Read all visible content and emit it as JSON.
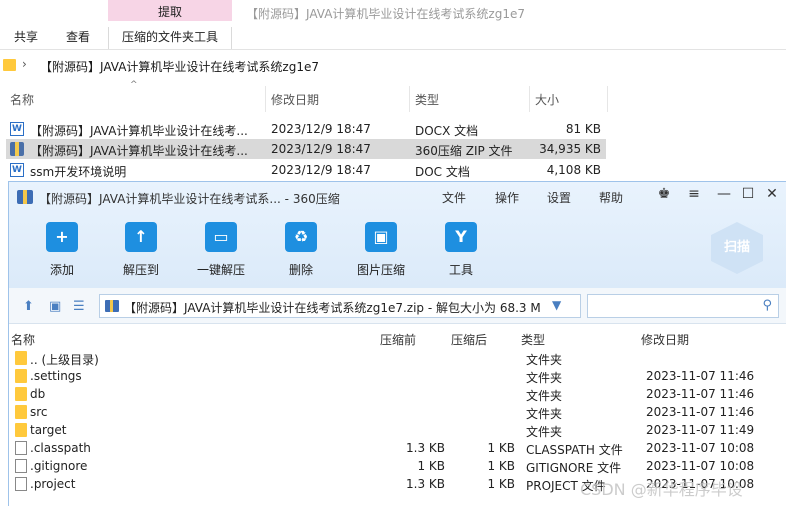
{
  "explorer": {
    "context_tab": "提取",
    "window_title": "【附源码】JAVA计算机毕业设计在线考试系统zg1e7",
    "ribbon_tabs": [
      "共享",
      "查看",
      "压缩的文件夹工具"
    ],
    "breadcrumb_arrow": "›",
    "address_path": "【附源码】JAVA计算机毕业设计在线考试系统zg1e7",
    "columns": {
      "name": "名称",
      "modified": "修改日期",
      "type": "类型",
      "size": "大小"
    },
    "files": [
      {
        "name": "【附源码】JAVA计算机毕业设计在线考...",
        "modified": "2023/12/9 18:47",
        "type": "DOCX 文档",
        "size": "81 KB",
        "icon": "word-doc-icon",
        "selected": false
      },
      {
        "name": "【附源码】JAVA计算机毕业设计在线考...",
        "modified": "2023/12/9 18:47",
        "type": "360压缩 ZIP 文件",
        "size": "34,935 KB",
        "icon": "zip-archive-icon",
        "selected": true
      },
      {
        "name": "ssm开发环境说明",
        "modified": "2023/12/9 18:47",
        "type": "DOC 文档",
        "size": "4,108 KB",
        "icon": "word-doc-icon",
        "selected": false
      }
    ]
  },
  "zip": {
    "title": "【附源码】JAVA计算机毕业设计在线考试系... - 360压缩",
    "menu": [
      "文件",
      "操作",
      "设置",
      "帮助"
    ],
    "tools": [
      {
        "label": "添加",
        "icon": "add-icon"
      },
      {
        "label": "解压到",
        "icon": "extract-to-icon"
      },
      {
        "label": "一键解压",
        "icon": "one-click-extract-icon"
      },
      {
        "label": "删除",
        "icon": "recycle-bin-icon"
      },
      {
        "label": "图片压缩",
        "icon": "image-compress-icon"
      },
      {
        "label": "工具",
        "icon": "toolbox-icon"
      }
    ],
    "scan_label": "扫描",
    "path_text": "【附源码】JAVA计算机毕业设计在线考试系统zg1e7.zip - 解包大小为 68.3 M",
    "columns": {
      "name": "名称",
      "before": "压缩前",
      "after": "压缩后",
      "type": "类型",
      "modified": "修改日期"
    },
    "entries": [
      {
        "name": ".. (上级目录)",
        "before": "",
        "after": "",
        "type": "文件夹",
        "modified": "",
        "kind": "folder"
      },
      {
        "name": ".settings",
        "before": "",
        "after": "",
        "type": "文件夹",
        "modified": "2023-11-07 11:46",
        "kind": "folder"
      },
      {
        "name": "db",
        "before": "",
        "after": "",
        "type": "文件夹",
        "modified": "2023-11-07 11:46",
        "kind": "folder"
      },
      {
        "name": "src",
        "before": "",
        "after": "",
        "type": "文件夹",
        "modified": "2023-11-07 11:46",
        "kind": "folder"
      },
      {
        "name": "target",
        "before": "",
        "after": "",
        "type": "文件夹",
        "modified": "2023-11-07 11:49",
        "kind": "folder"
      },
      {
        "name": ".classpath",
        "before": "1.3 KB",
        "after": "1 KB",
        "type": "CLASSPATH 文件",
        "modified": "2023-11-07 10:08",
        "kind": "file"
      },
      {
        "name": ".gitignore",
        "before": "1 KB",
        "after": "1 KB",
        "type": "GITIGNORE 文件",
        "modified": "2023-11-07 10:08",
        "kind": "file"
      },
      {
        "name": ".project",
        "before": "1.3 KB",
        "after": "1 KB",
        "type": "PROJECT 文件",
        "modified": "2023-11-07 10:08",
        "kind": "file"
      }
    ]
  },
  "watermark": "CSDN @新华程序毕设",
  "colors": {
    "accent": "#1e8fe0",
    "context_tab": "#f7d5e6",
    "folder": "#ffc93c",
    "selection": "#d9d9d9"
  }
}
